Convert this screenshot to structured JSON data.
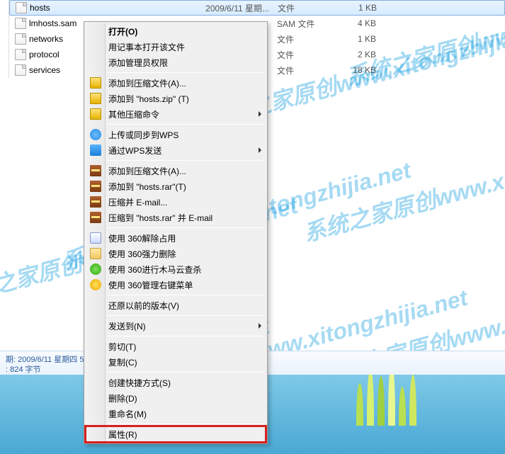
{
  "watermark_text": "系统之家原创www.xitongzhijia.net",
  "files": [
    {
      "name": "hosts",
      "date": "2009/6/11 星期...",
      "type": "文件",
      "size": "1 KB",
      "selected": true
    },
    {
      "name": "lmhosts.sam",
      "date": "",
      "type": "SAM 文件",
      "size": "4 KB",
      "selected": false
    },
    {
      "name": "networks",
      "date": "",
      "type": "文件",
      "size": "1 KB",
      "selected": false
    },
    {
      "name": "protocol",
      "date": "",
      "type": "文件",
      "size": "2 KB",
      "selected": false
    },
    {
      "name": "services",
      "date": "",
      "type": "文件",
      "size": "18 KB",
      "selected": false
    }
  ],
  "status": {
    "line1": "期: 2009/6/11 星期四 5",
    "line2": ": 824 字节"
  },
  "menu": {
    "open": "打开(O)",
    "notepad_open": "用记事本打开该文件",
    "add_admin": "添加管理员权限",
    "add_compress_a": "添加到压缩文件(A)...",
    "add_to_zip": "添加到 \"hosts.zip\" (T)",
    "other_compress": "其他压缩命令",
    "upload_wps": "上传或同步到WPS",
    "send_wps": "通过WPS发送",
    "add_compress_a2": "添加到压缩文件(A)...",
    "add_to_rar": "添加到 \"hosts.rar\"(T)",
    "compress_email": "压缩并 E-mail...",
    "compress_rar_email": "压缩到 \"hosts.rar\" 并 E-mail",
    "use_360_unlock": "使用 360解除占用",
    "use_360_delete": "使用 360强力删除",
    "use_360_trojan": "使用 360进行木马云查杀",
    "use_360_menu": "使用 360管理右键菜单",
    "restore_previous": "还原以前的版本(V)",
    "send_to": "发送到(N)",
    "cut": "剪切(T)",
    "copy": "复制(C)",
    "create_shortcut": "创建快捷方式(S)",
    "delete": "删除(D)",
    "rename": "重命名(M)",
    "properties": "属性(R)"
  }
}
